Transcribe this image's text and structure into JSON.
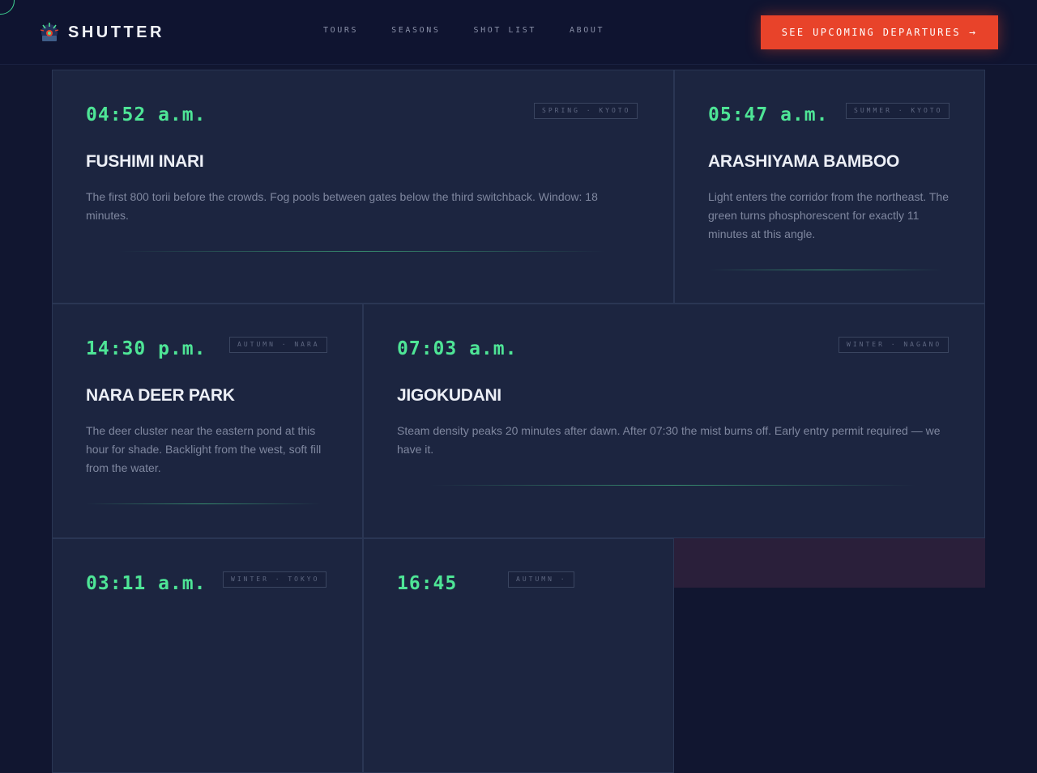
{
  "brand": {
    "name": "SHUTTER"
  },
  "nav": [
    "TOURS",
    "SEASONS",
    "SHOT LIST",
    "ABOUT"
  ],
  "cta": {
    "label": "SEE UPCOMING DEPARTURES",
    "arrow": "→"
  },
  "colors": {
    "accent": "#4ee596",
    "cta": "#e8432a",
    "background": "#111630",
    "card": "#1c2540"
  },
  "cards": [
    {
      "time": "04:52 a.m.",
      "tag": "SPRING · KYOTO",
      "title": "FUSHIMI INARI",
      "description": "The first 800 torii before the crowds. Fog pools between gates below the third switchback. Window: 18 minutes."
    },
    {
      "time": "05:47 a.m.",
      "tag": "SUMMER · KYOTO",
      "title": "ARASHIYAMA BAMBOO",
      "description": "Light enters the corridor from the northeast. The green turns phosphorescent for exactly 11 minutes at this angle."
    },
    {
      "time": "14:30 p.m.",
      "tag": "AUTUMN · NARA",
      "title": "NARA DEER PARK",
      "description": "The deer cluster near the eastern pond at this hour for shade. Backlight from the west, soft fill from the water."
    },
    {
      "time": "07:03 a.m.",
      "tag": "WINTER · NAGANO",
      "title": "JIGOKUDANI",
      "description": "Steam density peaks 20 minutes after dawn. After 07:30 the mist burns off. Early entry permit required — we have it."
    },
    {
      "time": "03:11 a.m.",
      "tag": "WINTER · TOKYO"
    },
    {
      "time": "16:45",
      "tag": "AUTUMN ·"
    }
  ]
}
